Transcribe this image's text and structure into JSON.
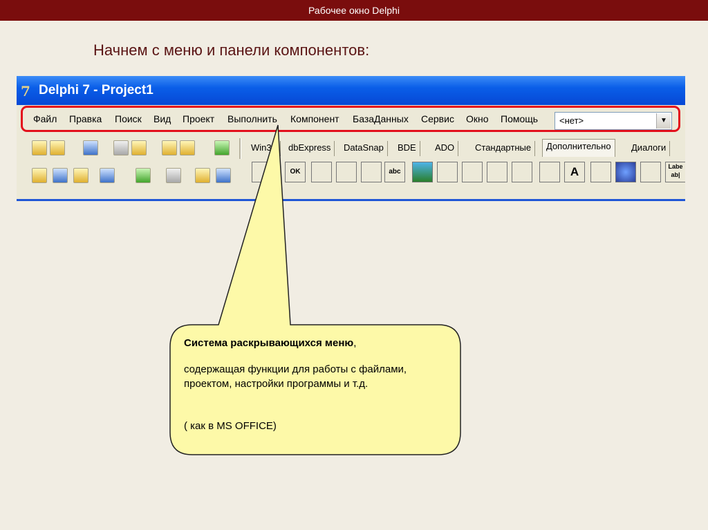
{
  "slide": {
    "header": "Рабочее окно Delphi",
    "subtitle": "Начнем с меню и панели компонентов:"
  },
  "window": {
    "title": "Delphi 7 - Project1"
  },
  "menu": {
    "items": [
      "Файл",
      "Правка",
      "Поиск",
      "Вид",
      "Проект",
      "Выполнить",
      "Компонент",
      "БазаДанных",
      "Сервис",
      "Окно",
      "Помощь"
    ],
    "combo_value": "<нет>"
  },
  "palette": {
    "tabs": [
      "Win32",
      "dbExpress",
      "DataSnap",
      "BDE",
      "ADO",
      "Стандартные",
      "Дополнительно",
      "Диалоги"
    ],
    "active_tab": "Дополнительно",
    "component_labels": {
      "static_text": "A",
      "label": "Labe",
      "label2": "ab|",
      "abc": "abc",
      "ok": "OK"
    }
  },
  "callout": {
    "title_bold": "Система раскрывающихся меню",
    "title_comma": ",",
    "body": "содержащая функции для работы с файлами, проектом, настройки программы и т.д.",
    "foot": "( как  в MS OFFICE)"
  },
  "colors": {
    "header_bg": "#7a0d0d",
    "title_bar": "#0a5ee8",
    "outline": "#e3101c",
    "callout_fill": "#fdf9a8"
  }
}
